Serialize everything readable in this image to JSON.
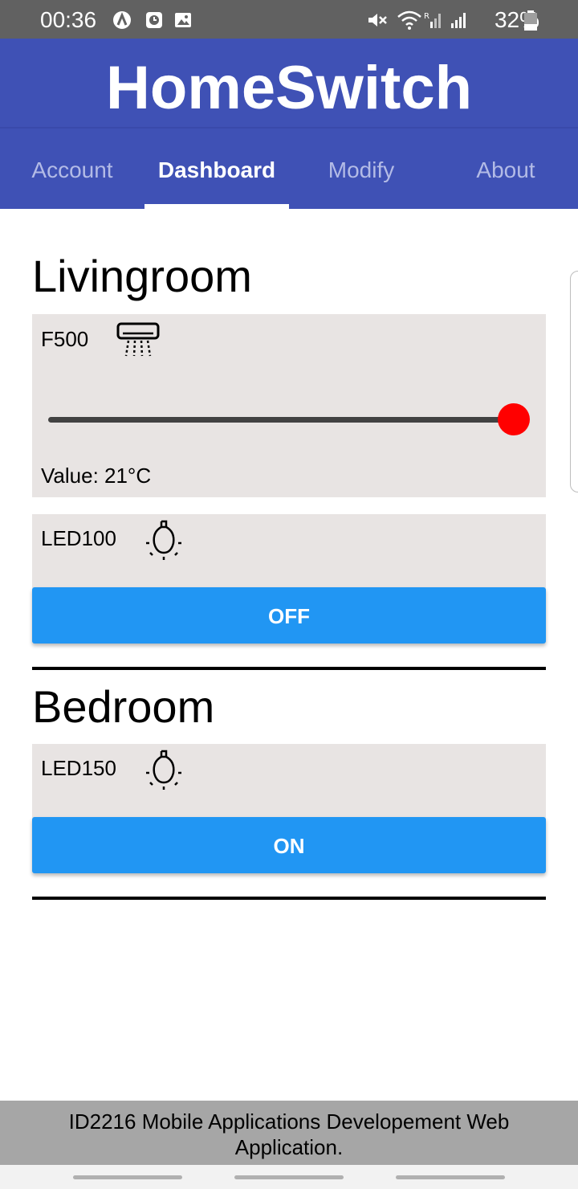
{
  "status_bar": {
    "time": "00:36",
    "battery": "32%",
    "icons": [
      "a-badge-icon",
      "clock-badge-icon",
      "image-icon",
      "mute-icon",
      "wifi-icon",
      "signal-roaming-icon",
      "signal-icon",
      "battery-icon"
    ]
  },
  "app": {
    "title": "HomeSwitch"
  },
  "tabs": [
    {
      "label": "Account"
    },
    {
      "label": "Dashboard"
    },
    {
      "label": "Modify"
    },
    {
      "label": "About"
    }
  ],
  "active_tab": "Dashboard",
  "rooms": [
    {
      "name": "Livingroom",
      "devices": [
        {
          "name": "F500",
          "icon": "air-conditioner-icon",
          "slider_fraction": 1.0,
          "value_text": "Value: 21°C"
        },
        {
          "name": "LED100",
          "icon": "lightbulb-icon",
          "button_label": "OFF"
        }
      ]
    },
    {
      "name": "Bedroom",
      "devices": [
        {
          "name": "LED150",
          "icon": "lightbulb-icon",
          "button_label": "ON"
        }
      ]
    }
  ],
  "footer": {
    "text": "ID2216 Mobile Applications Developement Web Application."
  },
  "colors": {
    "status_bar": "#616161",
    "app_bar": "#3f51b5",
    "card_bg": "#e8e4e3",
    "button": "#2196f3",
    "slider_thumb": "#ff0000",
    "footer": "#a6a6a6"
  }
}
